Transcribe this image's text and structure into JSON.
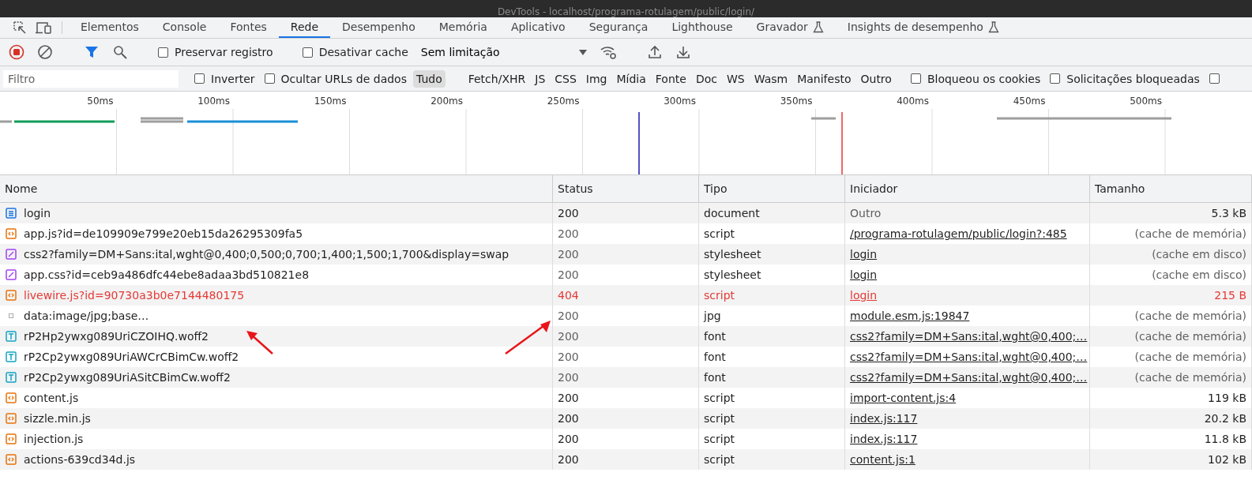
{
  "window": {
    "title": "DevTools - localhost/programa-rotulagem/public/login/"
  },
  "tabs": [
    {
      "label": "Elementos",
      "selected": false,
      "experimental": false
    },
    {
      "label": "Console",
      "selected": false,
      "experimental": false
    },
    {
      "label": "Fontes",
      "selected": false,
      "experimental": false
    },
    {
      "label": "Rede",
      "selected": true,
      "experimental": false
    },
    {
      "label": "Desempenho",
      "selected": false,
      "experimental": false
    },
    {
      "label": "Memória",
      "selected": false,
      "experimental": false
    },
    {
      "label": "Aplicativo",
      "selected": false,
      "experimental": false
    },
    {
      "label": "Segurança",
      "selected": false,
      "experimental": false
    },
    {
      "label": "Lighthouse",
      "selected": false,
      "experimental": false
    },
    {
      "label": "Gravador",
      "selected": false,
      "experimental": true
    },
    {
      "label": "Insights de desempenho",
      "selected": false,
      "experimental": true
    }
  ],
  "toolbar": {
    "recording": true,
    "filter_active": true,
    "checkboxes": [
      {
        "label": "Preservar registro",
        "checked": false
      },
      {
        "label": "Desativar cache",
        "checked": false
      }
    ],
    "throttling": "Sem limitação"
  },
  "filter_bar": {
    "placeholder": "Filtro",
    "left_checkboxes": [
      {
        "label": "Inverter",
        "checked": false
      },
      {
        "label": "Ocultar URLs de dados",
        "checked": false
      }
    ],
    "types": [
      {
        "label": "Tudo",
        "selected": true
      },
      {
        "label": "Fetch/XHR",
        "selected": false
      },
      {
        "label": "JS",
        "selected": false
      },
      {
        "label": "CSS",
        "selected": false
      },
      {
        "label": "Img",
        "selected": false
      },
      {
        "label": "Mídia",
        "selected": false
      },
      {
        "label": "Fonte",
        "selected": false
      },
      {
        "label": "Doc",
        "selected": false
      },
      {
        "label": "WS",
        "selected": false
      },
      {
        "label": "Wasm",
        "selected": false
      },
      {
        "label": "Manifesto",
        "selected": false
      },
      {
        "label": "Outro",
        "selected": false
      }
    ],
    "right_checkboxes": [
      {
        "label": "Bloqueou os cookies",
        "checked": false
      },
      {
        "label": "Solicitações bloqueadas",
        "checked": false
      },
      {
        "checked": false
      }
    ]
  },
  "overview": {
    "ticks": [
      "50ms",
      "100ms",
      "150ms",
      "200ms",
      "250ms",
      "300ms",
      "350ms",
      "400ms",
      "450ms",
      "500ms"
    ]
  },
  "table": {
    "columns": [
      "Nome",
      "Status",
      "Tipo",
      "Iniciador",
      "Tamanho"
    ],
    "rows": [
      {
        "kind": "page",
        "name": "login",
        "status": "200",
        "type": "document",
        "initiator": "Outro",
        "initiator_link": false,
        "size": "5.3 kB",
        "cached": false,
        "error": false
      },
      {
        "kind": "code",
        "name": "app.js?id=de109909e799e20eb15da26295309fa5",
        "status": "200",
        "type": "script",
        "initiator": "/programa-rotulagem/public/login?:485",
        "initiator_link": true,
        "size": "(cache de memória)",
        "cached": true,
        "error": false
      },
      {
        "kind": "pen",
        "name": "css2?family=DM+Sans:ital,wght@0,400;0,500;0,700;1,400;1,500;1,700&display=swap",
        "status": "200",
        "type": "stylesheet",
        "initiator": "login",
        "initiator_link": true,
        "size": "(cache em disco)",
        "cached": true,
        "error": false
      },
      {
        "kind": "pen",
        "name": "app.css?id=ceb9a486dfc44ebe8adaa3bd510821e8",
        "status": "200",
        "type": "stylesheet",
        "initiator": "login",
        "initiator_link": true,
        "size": "(cache em disco)",
        "cached": true,
        "error": false
      },
      {
        "kind": "code",
        "name": "livewire.js?id=90730a3b0e7144480175",
        "status": "404",
        "type": "script",
        "initiator": "login",
        "initiator_link": true,
        "size": "215 B",
        "error": true
      },
      {
        "kind": "square",
        "name": "data:image/jpg;base…",
        "status": "200",
        "type": "jpg",
        "initiator": "module.esm.js:19847",
        "initiator_link": true,
        "size": "(cache de memória)",
        "cached": true,
        "error": false
      },
      {
        "kind": "letter",
        "name": "rP2Hp2ywxg089UriCZOIHQ.woff2",
        "status": "200",
        "type": "font",
        "initiator": "css2?family=DM+Sans:ital,wght@0,400;…",
        "initiator_link": true,
        "size": "(cache de memória)",
        "cached": true,
        "error": false
      },
      {
        "kind": "letter",
        "name": "rP2Cp2ywxg089UriAWCrCBimCw.woff2",
        "status": "200",
        "type": "font",
        "initiator": "css2?family=DM+Sans:ital,wght@0,400;…",
        "initiator_link": true,
        "size": "(cache de memória)",
        "cached": true,
        "error": false
      },
      {
        "kind": "letter",
        "name": "rP2Cp2ywxg089UriASitCBimCw.woff2",
        "status": "200",
        "type": "font",
        "initiator": "css2?family=DM+Sans:ital,wght@0,400;…",
        "initiator_link": true,
        "size": "(cache de memória)",
        "cached": true,
        "error": false
      },
      {
        "kind": "code",
        "name": "content.js",
        "status": "200",
        "type": "script",
        "initiator": "import-content.js:4",
        "initiator_link": true,
        "size": "119 kB",
        "cached": false,
        "error": false
      },
      {
        "kind": "code",
        "name": "sizzle.min.js",
        "status": "200",
        "type": "script",
        "initiator": "index.js:117",
        "initiator_link": true,
        "size": "20.2 kB",
        "cached": false,
        "error": false
      },
      {
        "kind": "code",
        "name": "injection.js",
        "status": "200",
        "type": "script",
        "initiator": "index.js:117",
        "initiator_link": true,
        "size": "11.8 kB",
        "cached": false,
        "error": false
      },
      {
        "kind": "code",
        "name": "actions-639cd34d.js",
        "status": "200",
        "type": "script",
        "initiator": "content.js:1",
        "initiator_link": true,
        "size": "102 kB",
        "cached": false,
        "error": false
      }
    ]
  }
}
